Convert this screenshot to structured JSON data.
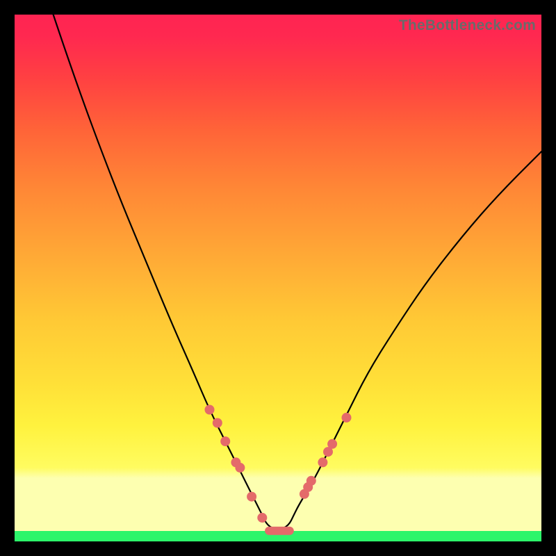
{
  "branding": "TheBottleneck.com",
  "gradient": {
    "green": "#2cf56a",
    "pale_yellow": "#fdffb0",
    "yellow": "#fff23e",
    "orange": "#ffa736",
    "red": "#ff2850"
  },
  "chart_data": {
    "type": "line",
    "title": "",
    "xlabel": "",
    "ylabel": "",
    "xlim": [
      0,
      100
    ],
    "ylim": [
      0,
      100
    ],
    "grid": false,
    "series": [
      {
        "name": "curve",
        "x": [
          7,
          10,
          15,
          20,
          25,
          30,
          34,
          37,
          40,
          43,
          46,
          47,
          48,
          50,
          52,
          53,
          54,
          57,
          60,
          63,
          67,
          72,
          78,
          85,
          92,
          100
        ],
        "y": [
          101,
          92,
          78,
          65,
          53,
          41,
          32,
          25,
          19,
          13,
          7,
          5,
          3,
          2,
          3,
          5,
          7,
          12,
          18,
          24,
          32,
          40,
          49,
          58,
          66,
          74
        ]
      },
      {
        "name": "left-markers",
        "x": [
          37.0,
          38.5,
          40.0,
          42.0,
          42.8,
          45.0,
          47.0
        ],
        "y": [
          25.0,
          22.5,
          19.0,
          15.0,
          14.0,
          8.5,
          4.5
        ]
      },
      {
        "name": "right-markers",
        "x": [
          55.0,
          55.7,
          56.3,
          58.5,
          59.5,
          60.3,
          63.0
        ],
        "y": [
          9.0,
          10.3,
          11.5,
          15.0,
          17.0,
          18.5,
          23.5
        ]
      },
      {
        "name": "flat-bottom",
        "x": [
          47.5,
          53.0
        ],
        "y": [
          2.0,
          2.0
        ]
      }
    ],
    "annotations": []
  }
}
